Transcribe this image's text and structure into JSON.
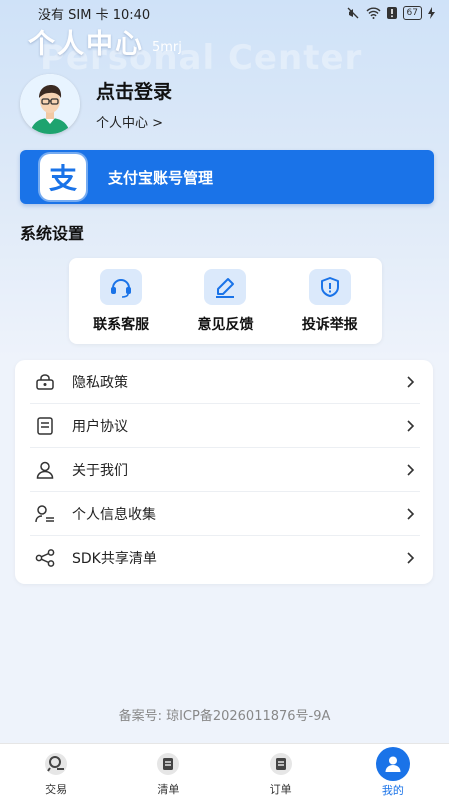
{
  "status_bar": {
    "carrier": "没有 SIM 卡",
    "time": "10:40",
    "battery": "67"
  },
  "header": {
    "title": "个人中心",
    "subtitle": "5mrj",
    "watermark": "Personal Center"
  },
  "profile": {
    "login_text": "点击登录",
    "link_text": "个人中心 >"
  },
  "alipay": {
    "icon_text": "支",
    "label": "支付宝账号管理"
  },
  "settings": {
    "title": "系统设置"
  },
  "quick_actions": [
    {
      "label": "联系客服",
      "icon": "headset-icon"
    },
    {
      "label": "意见反馈",
      "icon": "edit-icon"
    },
    {
      "label": "投诉举报",
      "icon": "shield-icon"
    }
  ],
  "menu": [
    {
      "label": "隐私政策",
      "icon": "lock-icon"
    },
    {
      "label": "用户协议",
      "icon": "document-icon"
    },
    {
      "label": "关于我们",
      "icon": "user-icon"
    },
    {
      "label": "个人信息收集",
      "icon": "user-edit-icon"
    },
    {
      "label": "SDK共享清单",
      "icon": "share-icon"
    }
  ],
  "footer": {
    "icp": "备案号:  琼ICP备2026011876号-9A"
  },
  "tabs": [
    {
      "label": "交易",
      "active": false
    },
    {
      "label": "清单",
      "active": false
    },
    {
      "label": "订单",
      "active": false
    },
    {
      "label": "我的",
      "active": true
    }
  ],
  "colors": {
    "accent": "#1a73e8",
    "background": "#eef3fb"
  }
}
